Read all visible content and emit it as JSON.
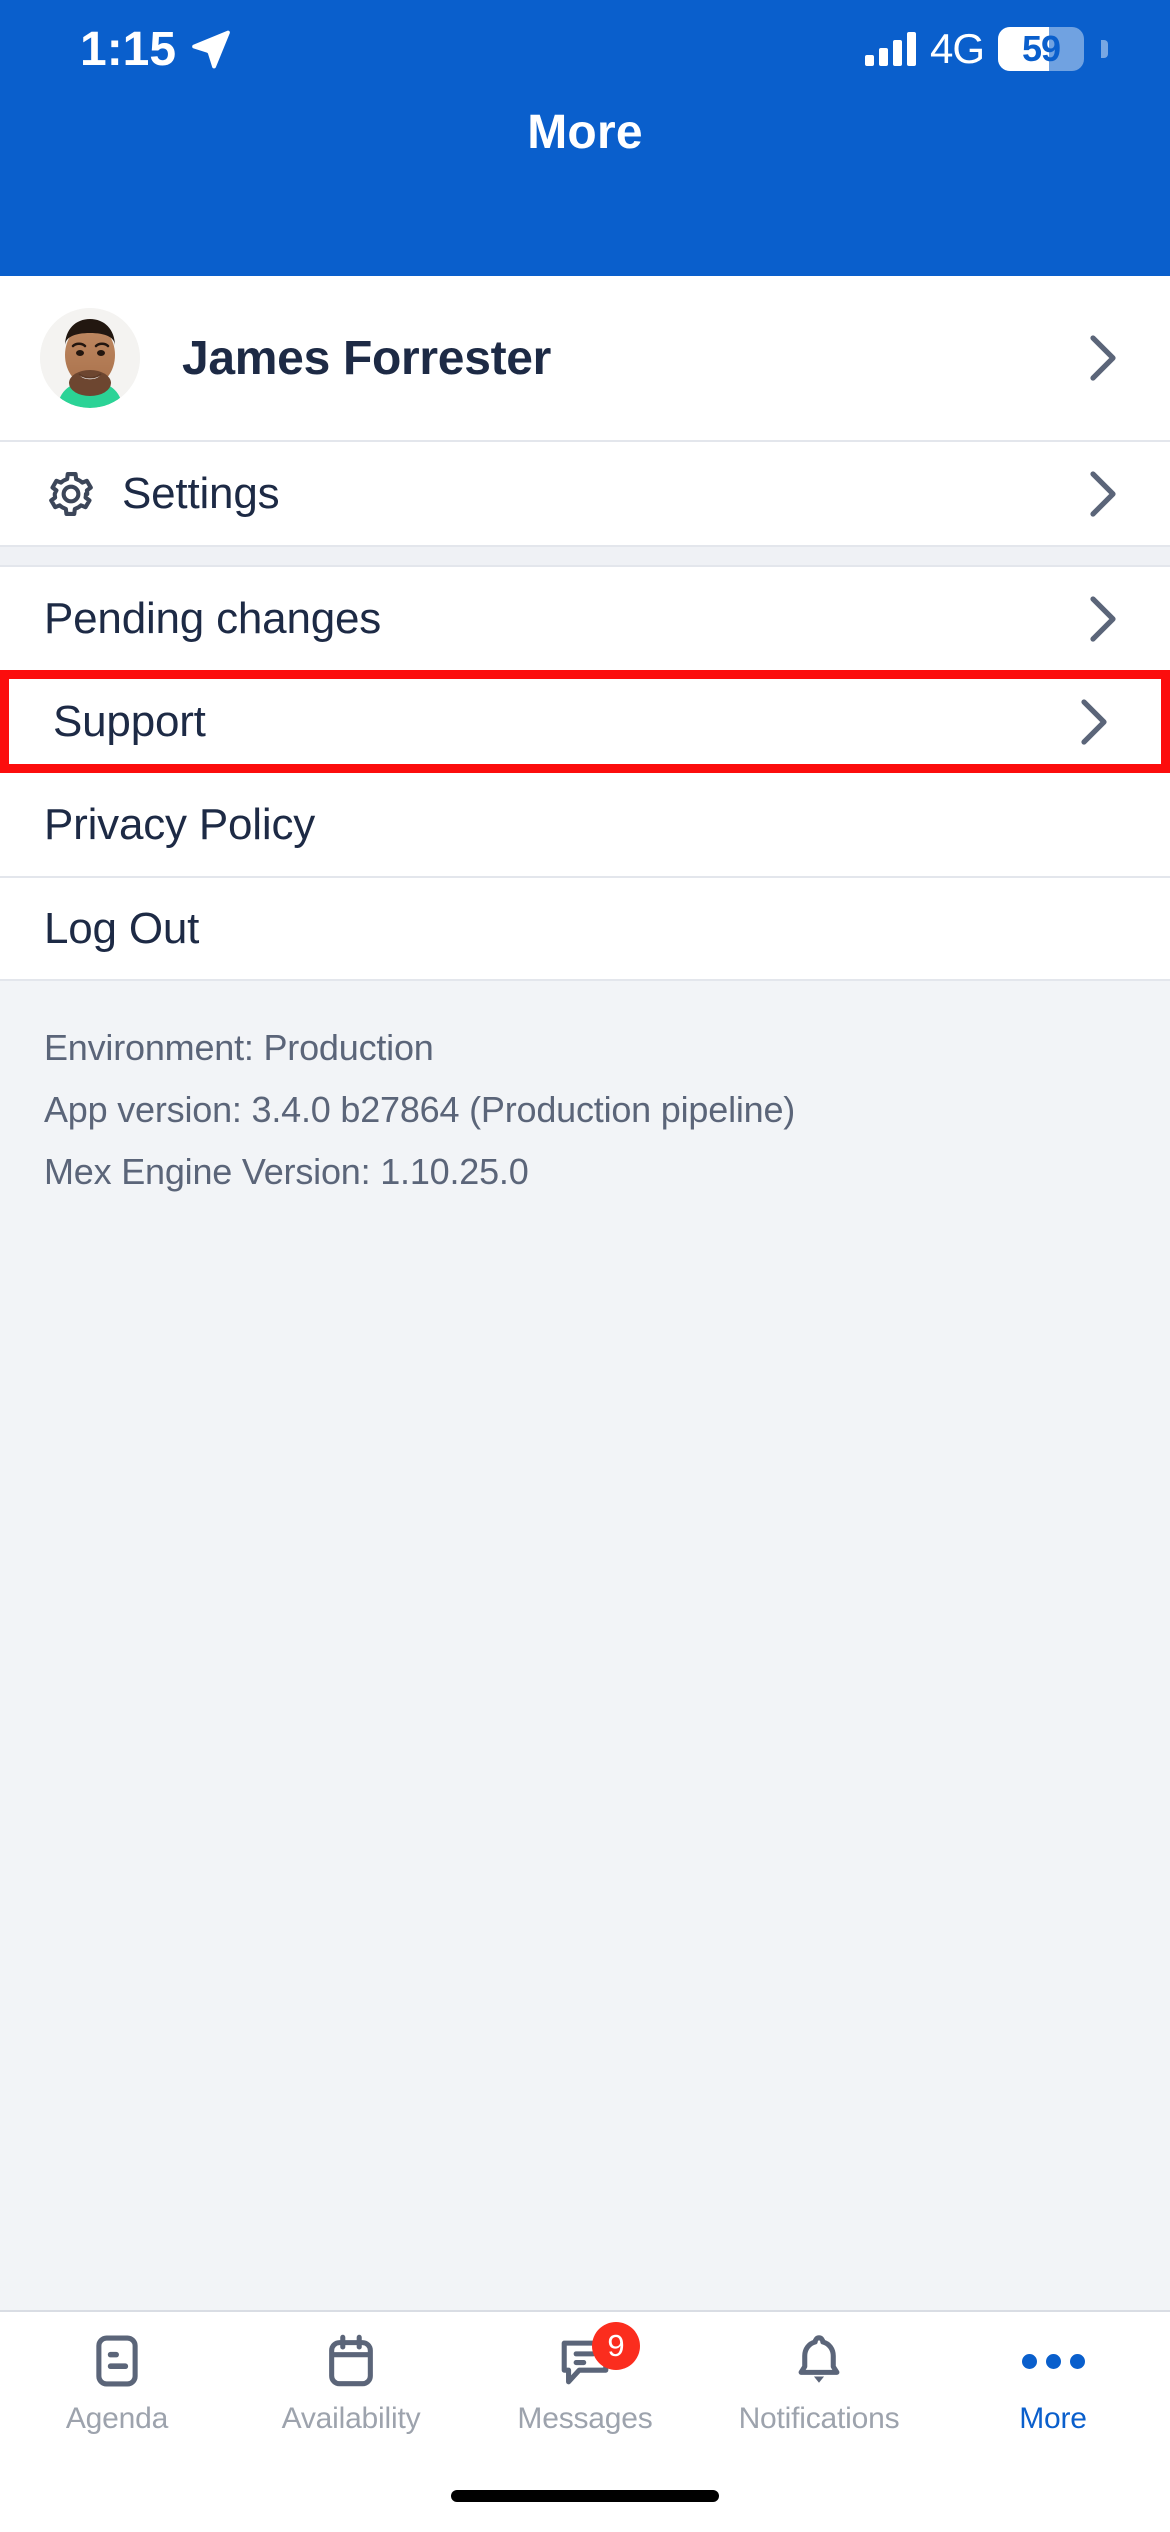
{
  "status_bar": {
    "time": "1:15",
    "location_icon": "location-arrow-icon",
    "network": "4G",
    "battery_percent": "59",
    "signal_icon": "cellular-signal-icon"
  },
  "nav": {
    "title": "More"
  },
  "profile": {
    "name": "James Forrester",
    "avatar_icon": "user-avatar-photo",
    "chevron_icon": "chevron-right-icon"
  },
  "menu": {
    "settings": {
      "label": "Settings",
      "icon": "gear-icon",
      "chevron_icon": "chevron-right-icon"
    },
    "items": [
      {
        "label": "Pending changes",
        "chevron": true
      },
      {
        "label": "Support",
        "chevron": true,
        "highlighted": true
      },
      {
        "label": "Privacy Policy",
        "chevron": false
      },
      {
        "label": "Log Out",
        "chevron": false
      }
    ]
  },
  "version_info": {
    "environment": "Environment: Production",
    "app_version": "App version: 3.4.0 b27864 (Production pipeline)",
    "engine_version": "Mex Engine Version: 1.10.25.0"
  },
  "tab_bar": {
    "tabs": [
      {
        "label": "Agenda",
        "icon": "agenda-list-icon",
        "active": false,
        "badge": null
      },
      {
        "label": "Availability",
        "icon": "calendar-icon",
        "active": false,
        "badge": null
      },
      {
        "label": "Messages",
        "icon": "chat-bubble-icon",
        "active": false,
        "badge": "9"
      },
      {
        "label": "Notifications",
        "icon": "bell-icon",
        "active": false,
        "badge": null
      },
      {
        "label": "More",
        "icon": "ellipsis-icon",
        "active": true,
        "badge": null
      }
    ]
  },
  "colors": {
    "brand_blue": "#0a5fcc",
    "highlight_red": "#fc0d0d",
    "badge_red": "#fb2d1e",
    "text_dark": "#1d2a45",
    "text_muted": "#5b6579",
    "tab_inactive": "#9da3ad"
  }
}
